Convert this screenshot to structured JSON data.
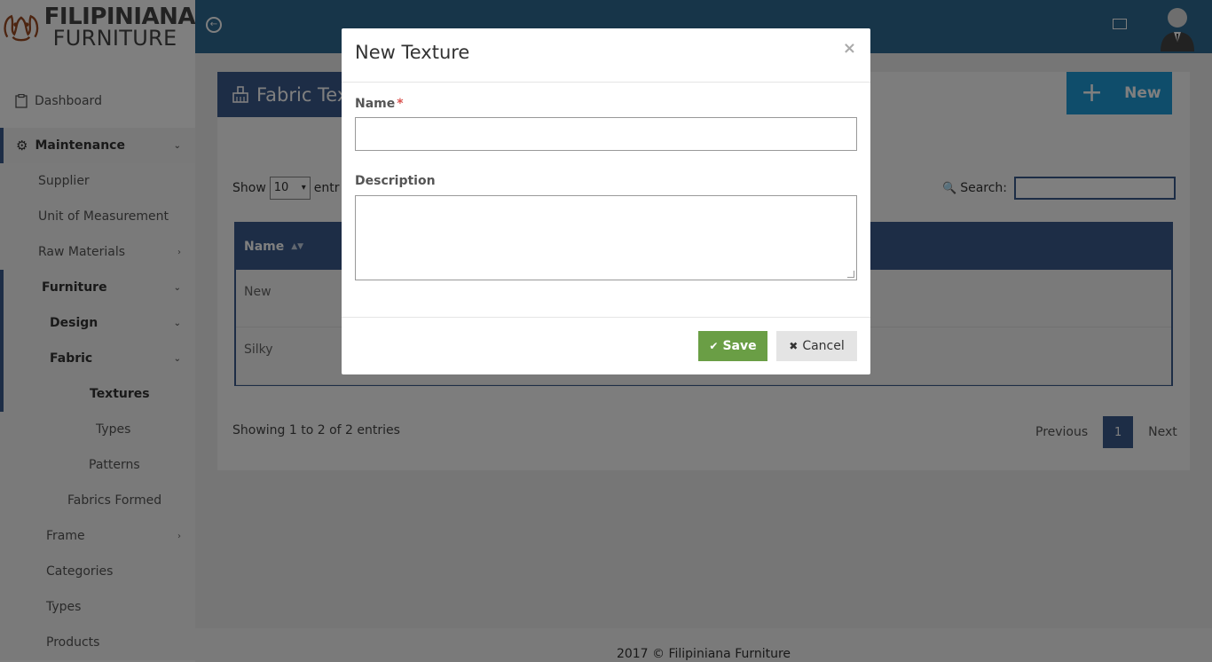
{
  "brand": {
    "line1": "FILIPINIANA",
    "line2": "FURNITURE"
  },
  "sidebar": {
    "items": [
      {
        "label": "Dashboard",
        "icon": "clipboard-icon"
      },
      {
        "label": "Maintenance",
        "icon": "gear-icon"
      },
      {
        "label": "Supplier"
      },
      {
        "label": "Unit of Measurement"
      },
      {
        "label": "Raw Materials"
      },
      {
        "label": "Furniture"
      },
      {
        "label": "Design"
      },
      {
        "label": "Fabric"
      },
      {
        "label": "Textures"
      },
      {
        "label": "Types"
      },
      {
        "label": "Patterns"
      },
      {
        "label": "Fabrics Formed"
      },
      {
        "label": "Frame"
      },
      {
        "label": "Categories"
      },
      {
        "label": "Types"
      },
      {
        "label": "Products"
      }
    ]
  },
  "page": {
    "title": "Fabric Tex",
    "new_label": "New",
    "show_label": "Show",
    "entries_value": "10",
    "entries_suffix": "entr",
    "search_label": "Search:",
    "table": {
      "headers": [
        "Name"
      ],
      "rows": [
        [
          "New"
        ],
        [
          "Silky"
        ]
      ]
    },
    "info": "Showing 1 to 2 of 2 entries",
    "pager": {
      "previous": "Previous",
      "current": "1",
      "next": "Next"
    }
  },
  "footer": {
    "text": "2017 © Filipiniana Furniture"
  },
  "modal": {
    "title": "New Texture",
    "close": "×",
    "name_label": "Name",
    "required_mark": "*",
    "description_label": "Description",
    "save_label": "Save",
    "cancel_label": "Cancel"
  },
  "colors": {
    "primary": "#3a5a8c",
    "topbar": "#2e6a92",
    "new_button": "#1e9bd7",
    "save": "#6a9e45"
  }
}
